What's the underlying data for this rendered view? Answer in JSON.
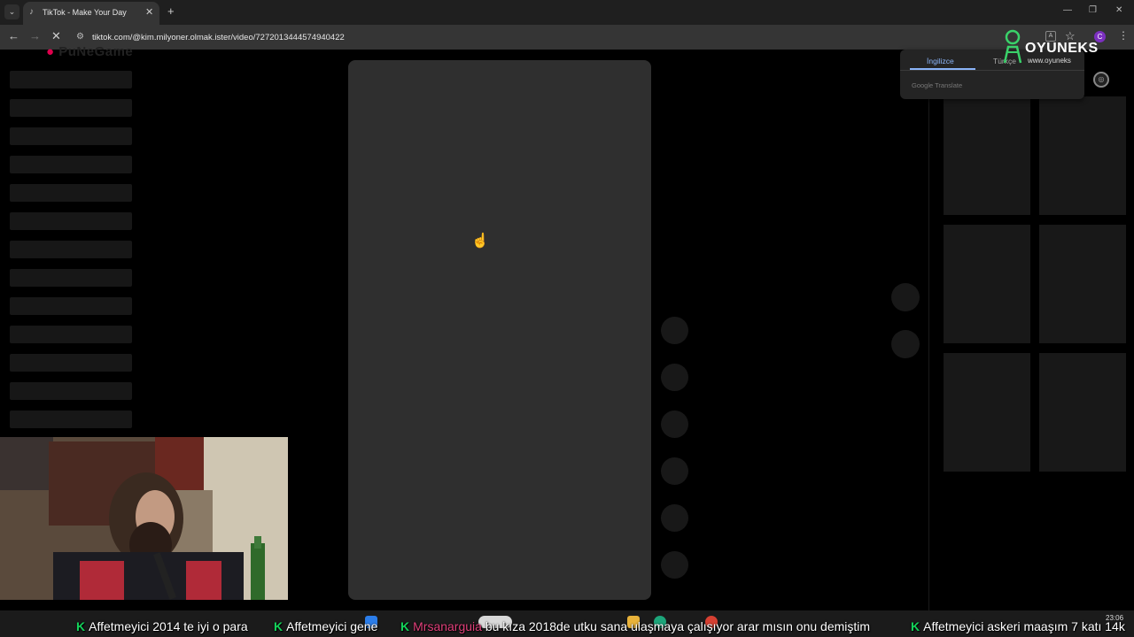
{
  "browser": {
    "tab": {
      "title": "TikTok - Make Your Day"
    },
    "url": "tiktok.com/@kim.milyoner.olmak.ister/video/7272013444574940422",
    "profile_initial": "C"
  },
  "translate_popup": {
    "tab_source": "İngilizce",
    "tab_target": "Türkçe",
    "footer": "Google Translate"
  },
  "overlay": {
    "brand_name": "OYUNEKS",
    "brand_url": "www.oyuneks",
    "logo_text": "PuNeGame"
  },
  "chat_ticker": [
    {
      "user": "Affetmeyici",
      "text": "2014 te iyi o para",
      "user_color": "#ffffff"
    },
    {
      "user": "Affetmeyici",
      "text": "gene",
      "user_color": "#ffffff"
    },
    {
      "user": "Mrsanarguia",
      "text": "bu kıza 2018de utku sana ulaşmaya çalışıyor arar mısın onu demiştim",
      "user_color": "#e0407a"
    },
    {
      "user": "Affetmeyici",
      "text": "askeri maaşım 7 katı 14k",
      "user_color": "#ffffff"
    }
  ],
  "system": {
    "time": "23:06"
  },
  "colors": {
    "accent": "#8ab4f8",
    "skeleton": "#171717",
    "video_card": "#2f2f2f",
    "brand": "#e0004d",
    "chat_badge": "#14d25a"
  }
}
